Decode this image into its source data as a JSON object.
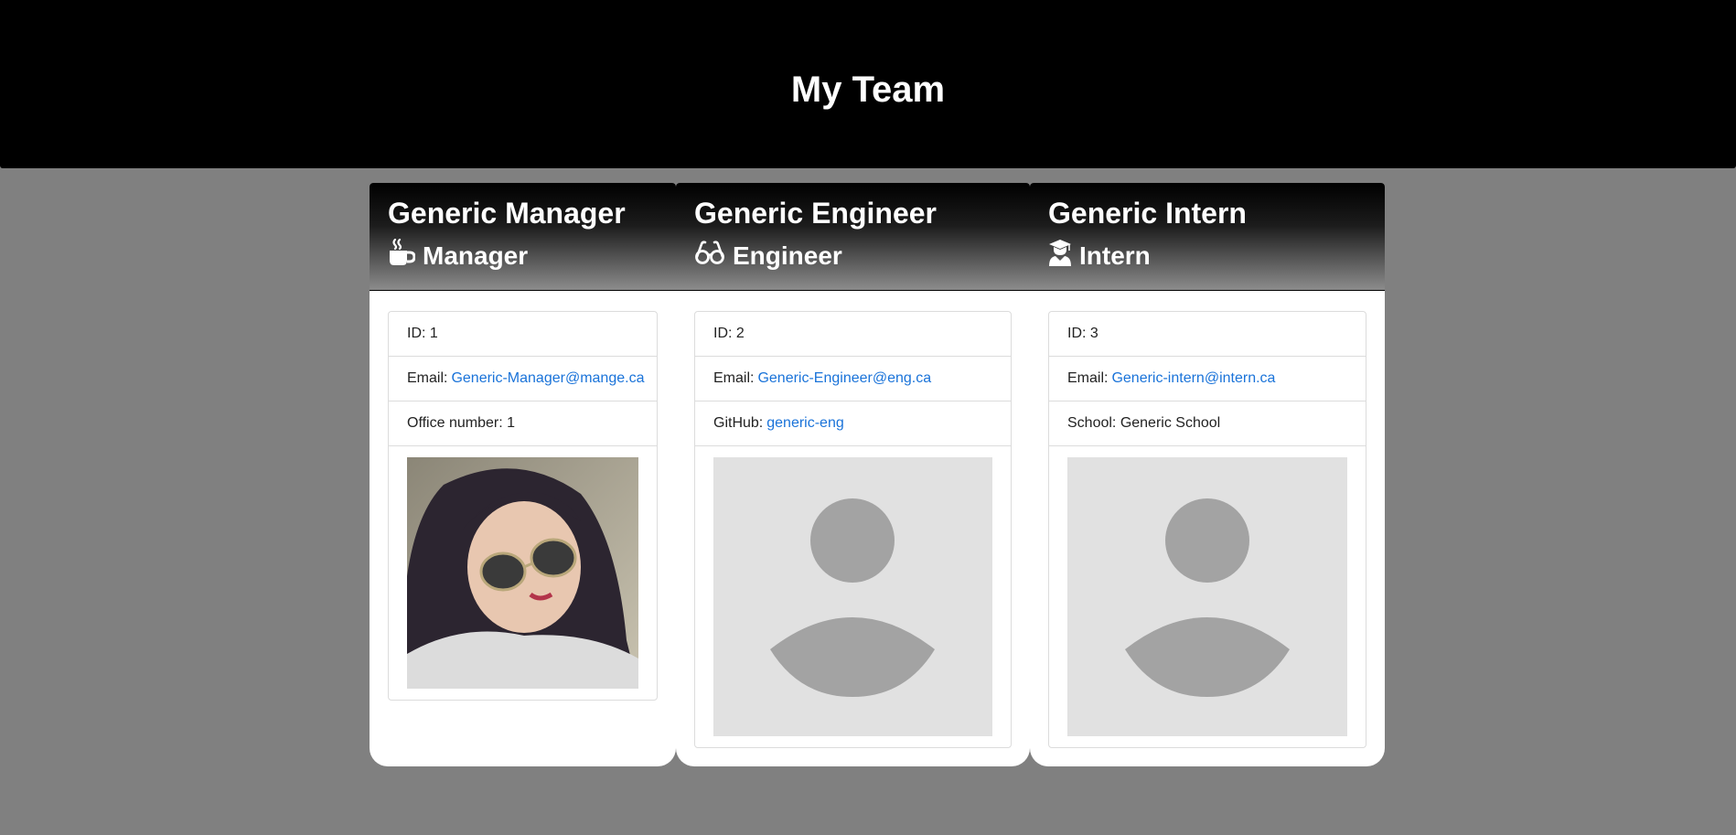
{
  "header": {
    "title": "My Team"
  },
  "cards": [
    {
      "name": "Generic Manager",
      "role": "Manager",
      "role_icon": "mug-hot-icon",
      "rows": [
        {
          "label": "ID: 1",
          "link": ""
        },
        {
          "label": "Email:",
          "link": "Generic-Manager@mange.ca"
        },
        {
          "label": "Office number: 1",
          "link": ""
        }
      ],
      "photo": "profile-photo"
    },
    {
      "name": "Generic Engineer",
      "role": "Engineer",
      "role_icon": "glasses-icon",
      "rows": [
        {
          "label": "ID: 2",
          "link": ""
        },
        {
          "label": "Email:",
          "link": "Generic-Engineer@eng.ca"
        },
        {
          "label": "GitHub:",
          "link": "generic-eng"
        }
      ],
      "photo": "avatar-placeholder"
    },
    {
      "name": "Generic Intern",
      "role": "Intern",
      "role_icon": "user-graduate-icon",
      "rows": [
        {
          "label": "ID: 3",
          "link": ""
        },
        {
          "label": "Email:",
          "link": "Generic-intern@intern.ca"
        },
        {
          "label": "School: Generic School",
          "link": ""
        }
      ],
      "photo": "avatar-placeholder"
    }
  ]
}
